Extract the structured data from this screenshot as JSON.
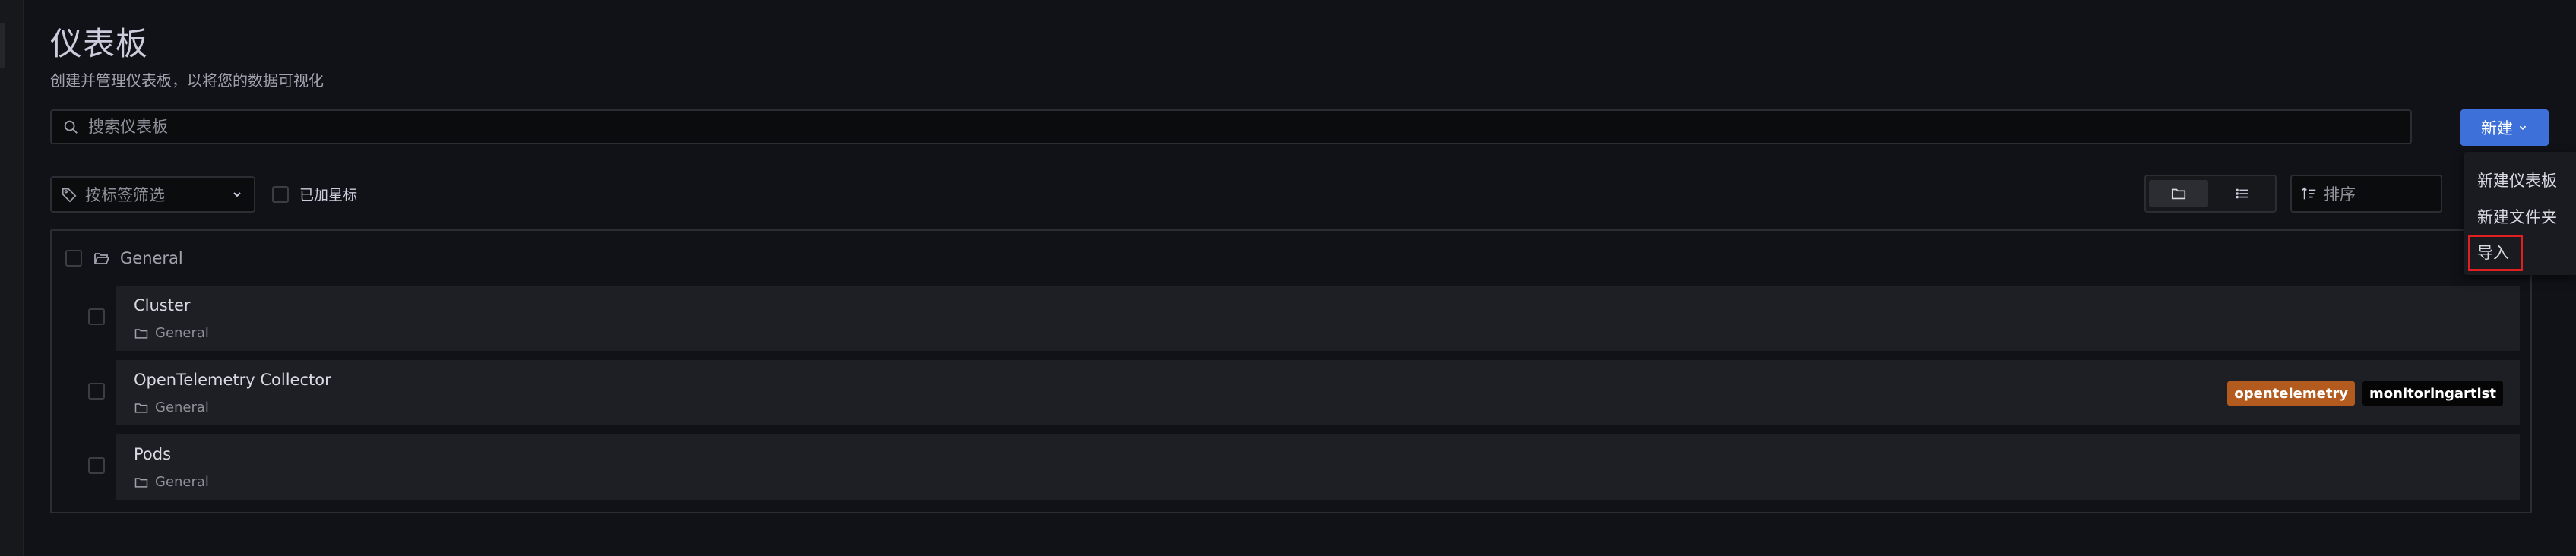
{
  "header": {
    "title": "仪表板",
    "subtitle": "创建并管理仪表板，以将您的数据可视化"
  },
  "search": {
    "placeholder": "搜索仪表板",
    "value": ""
  },
  "toolbar": {
    "new_label": "新建",
    "tag_filter_label": "按标签筛选",
    "starred_label": "已加星标",
    "sort_placeholder": "排序",
    "view_mode": "folders"
  },
  "new_menu": {
    "items": [
      "新建仪表板",
      "新建文件夹",
      "导入"
    ],
    "highlighted": "导入"
  },
  "folder": {
    "name": "General"
  },
  "dashboards": [
    {
      "title": "Cluster",
      "folder": "General",
      "tags": []
    },
    {
      "title": "OpenTelemetry Collector",
      "folder": "General",
      "tags": [
        {
          "label": "opentelemetry",
          "color": "#b35a1f"
        },
        {
          "label": "monitoringartist",
          "color": "#050505"
        }
      ]
    },
    {
      "title": "Pods",
      "folder": "General",
      "tags": []
    }
  ],
  "colors": {
    "background": "#111217",
    "primary_button": "#3d71d9",
    "highlight_border": "#e02020"
  }
}
